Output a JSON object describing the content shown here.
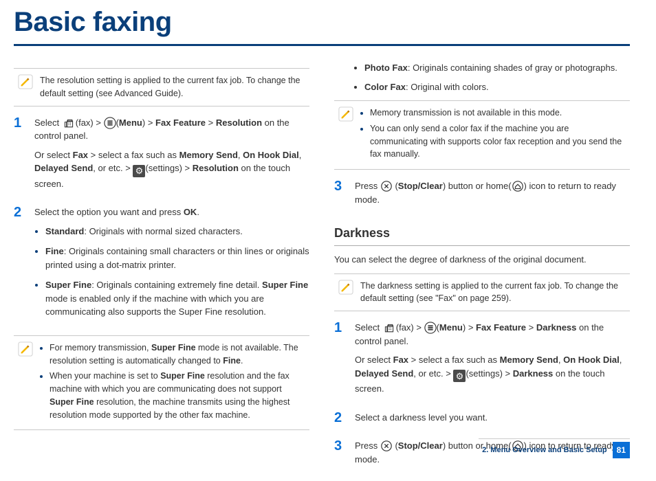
{
  "title": "Basic faxing",
  "left": {
    "note1": "The resolution setting is applied to the current fax job. To change the default setting (see Advanced Guide).",
    "step1": {
      "num": "1",
      "p1a": "Select ",
      "p1b": "(fax) > ",
      "p1c": "(",
      "p1d": "Menu",
      "p1e": ") > ",
      "p1f": "Fax Feature",
      "p1g": " > ",
      "p1h": "Resolution",
      "p1i": " on the control panel.",
      "p2a": "Or select ",
      "p2b": "Fax",
      "p2c": " > select a fax such as ",
      "p2d": "Memory Send",
      "p2e": ", ",
      "p2f": "On Hook Dial",
      "p2g": ", ",
      "p2h": "Delayed Send",
      "p2i": ", or etc. > ",
      "p2j": "(settings) > ",
      "p2k": "Resolution",
      "p2l": " on the touch screen."
    },
    "step2": {
      "num": "2",
      "intro_a": "Select the option you want and press ",
      "intro_b": "OK",
      "intro_c": ".",
      "standard_l": "Standard",
      "standard_t": ": Originals with normal sized characters.",
      "fine_l": "Fine",
      "fine_t": ": Originals containing small characters or thin lines or originals printed using a dot-matrix printer.",
      "super_l": "Super Fine",
      "super_t1": ": Originals containing extremely fine detail. ",
      "super_t2": "Super Fine",
      "super_t3": " mode is enabled only if the machine with which you are communicating also supports the Super Fine resolution."
    },
    "note2": {
      "b1a": "For memory transmission, ",
      "b1b": "Super Fine",
      "b1c": " mode is not available. The resolution setting is automatically changed to ",
      "b1d": "Fine",
      "b1e": ".",
      "b2a": "When your machine is set to ",
      "b2b": "Super Fine",
      "b2c": " resolution and the fax machine with which you are communicating does not support ",
      "b2d": "Super Fine",
      "b2e": " resolution, the machine transmits using the highest resolution mode supported by the other fax machine."
    }
  },
  "right": {
    "photo_l": "Photo Fax",
    "photo_t": ": Originals containing shades of gray or photographs.",
    "color_l": "Color Fax",
    "color_t": ": Original with colors.",
    "note1": {
      "b1": "Memory transmission is not available in this mode.",
      "b2": "You can only send a color fax if the machine you are communicating with supports color fax reception and you send the fax manually."
    },
    "step3": {
      "num": "3",
      "a": "Press ",
      "b": " (",
      "c": "Stop/Clear",
      "d": ") button or home(",
      "e": ") icon to return to ready mode."
    },
    "darkness_head": "Darkness",
    "darkness_text": "You can select the degree of darkness of the original document.",
    "note2": "The darkness setting is applied to the current fax job. To change the default setting (see \"Fax\" on page 259).",
    "dstep1": {
      "num": "1",
      "p1a": "Select ",
      "p1b": "(fax) > ",
      "p1c": "(",
      "p1d": "Menu",
      "p1e": ") > ",
      "p1f": "Fax Feature",
      "p1g": " > ",
      "p1h": "Darkness",
      "p1i": " on the control panel.",
      "p2a": "Or select ",
      "p2b": "Fax",
      "p2c": " > select a fax such as ",
      "p2d": "Memory Send",
      "p2e": ", ",
      "p2f": "On Hook Dial",
      "p2g": ", ",
      "p2h": "Delayed Send",
      "p2i": ", or etc. > ",
      "p2j": "(settings) > ",
      "p2k": "Darkness",
      "p2l": " on the touch screen."
    },
    "dstep2": {
      "num": "2",
      "text": "Select a darkness level you want."
    },
    "dstep3": {
      "num": "3",
      "a": "Press ",
      "b": " (",
      "c": "Stop/Clear",
      "d": ") button or home(",
      "e": ") icon to return to ready mode."
    }
  },
  "footer": {
    "chapter": "2. Menu Overview and Basic Setup",
    "page": "81"
  }
}
